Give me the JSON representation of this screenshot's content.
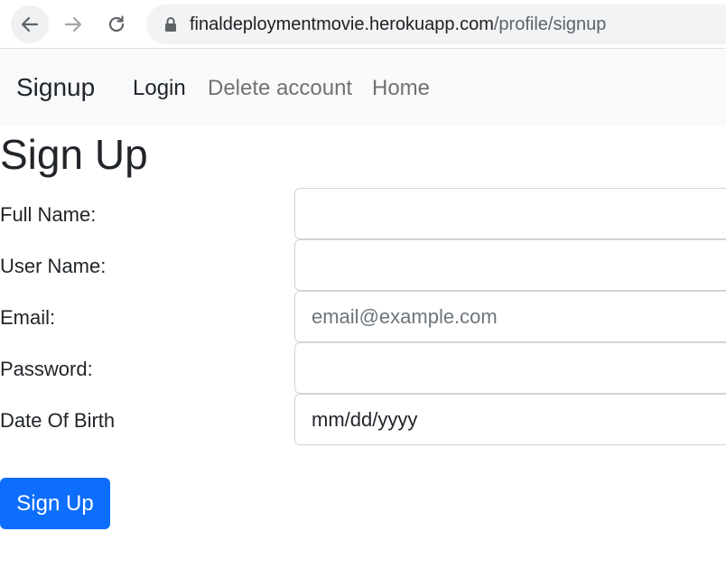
{
  "browser": {
    "url_host": "finaldeploymentmovie.herokuapp.com",
    "url_path": "/profile/signup"
  },
  "navbar": {
    "brand": "Signup",
    "links": [
      "Login",
      "Delete account",
      "Home"
    ]
  },
  "page": {
    "title": "Sign Up"
  },
  "form": {
    "fields": [
      {
        "label": "Full Name:",
        "value": "",
        "placeholder": ""
      },
      {
        "label": "User Name:",
        "value": "",
        "placeholder": ""
      },
      {
        "label": "Email:",
        "value": "",
        "placeholder": "email@example.com"
      },
      {
        "label": "Password:",
        "value": "",
        "placeholder": ""
      },
      {
        "label": "Date Of Birth",
        "value": "mm/dd/yyyy",
        "placeholder": ""
      }
    ],
    "submit_label": "Sign Up"
  },
  "colors": {
    "primary": "#0d6efd",
    "navbar_bg": "#f8f9fa",
    "text": "#212529",
    "muted_link": "#8c8c8c"
  }
}
